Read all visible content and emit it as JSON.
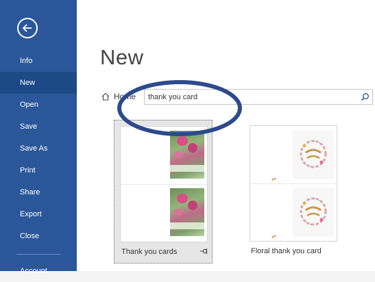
{
  "sidebar": {
    "back_label": "Back",
    "items": [
      {
        "label": "Info"
      },
      {
        "label": "New"
      },
      {
        "label": "Open"
      },
      {
        "label": "Save"
      },
      {
        "label": "Save As"
      },
      {
        "label": "Print"
      },
      {
        "label": "Share"
      },
      {
        "label": "Export"
      },
      {
        "label": "Close"
      },
      {
        "label": "Account"
      }
    ],
    "active_item": "New",
    "color": "#2b579a"
  },
  "main": {
    "title": "New",
    "home_label": "Home",
    "search": {
      "value": "thank you card",
      "icon": "search-icon"
    },
    "annotation_color": "#2d4a8c",
    "templates": [
      {
        "label": "Thank you cards",
        "selected": true,
        "pin": "pin-icon"
      },
      {
        "label": "Floral thank you card",
        "selected": false
      }
    ]
  }
}
